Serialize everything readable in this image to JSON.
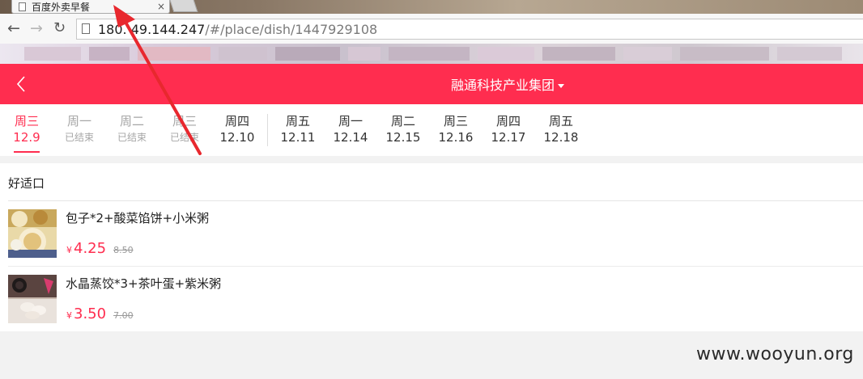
{
  "browser": {
    "tab_title": "百度外卖早餐",
    "url_host": "180.  49.144.247",
    "url_path": "/#/place/dish/1447929108"
  },
  "header": {
    "title": "融通科技产业集团"
  },
  "dates": [
    {
      "week": "周三",
      "sub": "12.9",
      "state": "active"
    },
    {
      "week": "周一",
      "sub": "已结束",
      "state": "ended"
    },
    {
      "week": "周二",
      "sub": "已结束",
      "state": "ended"
    },
    {
      "week": "周三",
      "sub": "已结束",
      "state": "ended"
    },
    {
      "week": "周四",
      "sub": "12.10",
      "state": "normal"
    },
    {
      "week": "周五",
      "sub": "12.11",
      "state": "normal"
    },
    {
      "week": "周一",
      "sub": "12.14",
      "state": "normal"
    },
    {
      "week": "周二",
      "sub": "12.15",
      "state": "normal"
    },
    {
      "week": "周三",
      "sub": "12.16",
      "state": "normal"
    },
    {
      "week": "周四",
      "sub": "12.17",
      "state": "normal"
    },
    {
      "week": "周五",
      "sub": "12.18",
      "state": "normal"
    }
  ],
  "store": {
    "name": "好适口",
    "dishes": [
      {
        "name": "包子*2+酸菜馅饼+小米粥",
        "currency": "¥",
        "price": "4.25",
        "original_price": "8.50"
      },
      {
        "name": "水晶蒸饺*3+茶叶蛋+紫米粥",
        "currency": "¥",
        "price": "3.50",
        "original_price": "7.00"
      }
    ]
  },
  "watermark": "www.wooyun.org",
  "colors": {
    "brand": "#ff2d4f",
    "annotation_arrow": "#e8282e"
  },
  "icons": {
    "back": "chevron-left-icon",
    "dropdown": "caret-down-icon"
  }
}
